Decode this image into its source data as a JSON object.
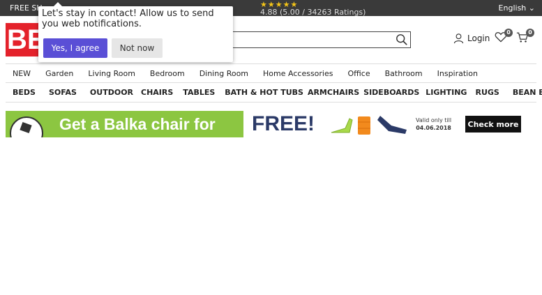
{
  "topbar": {
    "shipping_text": "FREE SH",
    "stars": "★★★★★",
    "rating_text": "4.88 (5.00 / 34263 Ratings)",
    "language": "English"
  },
  "header": {
    "logo_text": "BE",
    "search_placeholder": "",
    "login_label": "Login",
    "wishlist_count": "0",
    "cart_count": "0"
  },
  "popup": {
    "message": "Let's stay in contact! Allow us to send you web notifications.",
    "agree_label": "Yes, I agree",
    "not_now_label": "Not now"
  },
  "nav_primary": [
    "NEW",
    "Garden",
    "Living Room",
    "Bedroom",
    "Dining Room",
    "Home Accessories",
    "Office",
    "Bathroom",
    "Inspiration"
  ],
  "nav_categories": [
    "BEDS",
    "SOFAS",
    "OUTDOOR",
    "CHAIRS",
    "TABLES",
    "BATH & HOT TUBS",
    "ARMCHAIRS",
    "SIDEBOARDS",
    "LIGHTING",
    "RUGS",
    "BEAN BAGS"
  ],
  "banner": {
    "headline": "Get a Balka chair for",
    "headline_emphasis": "FREE!",
    "valid_text": "Valid only till",
    "valid_date": "04.06.2018",
    "cta_label": "Check more"
  },
  "colors": {
    "brand_red": "#e4222b",
    "topbar_bg": "#3a3a3a",
    "agree_button": "#5a4fd6",
    "banner_green": "#8cc641",
    "banner_navy": "#2b3a67"
  }
}
